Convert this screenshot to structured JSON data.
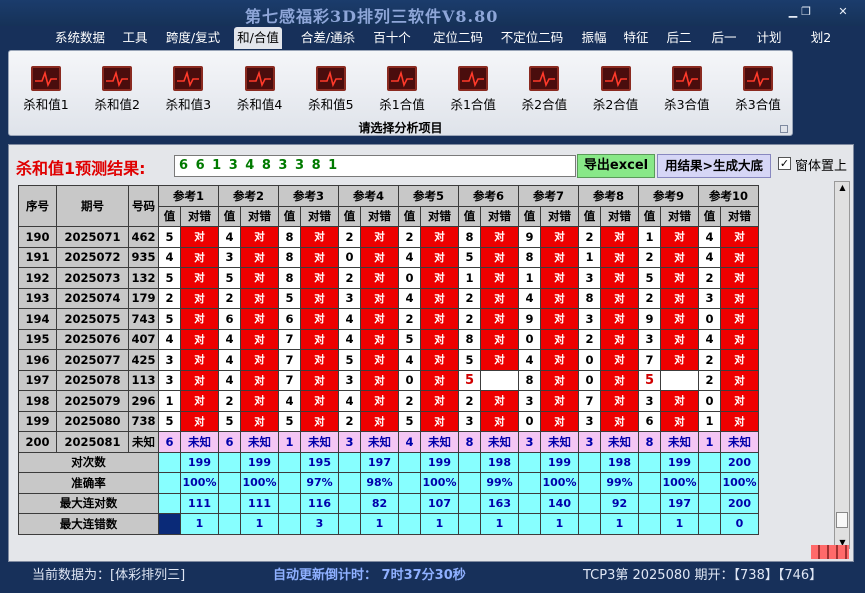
{
  "app": {
    "title": "第七感福彩3D排列三软件V8.80"
  },
  "menu": [
    "系统数据",
    "工具",
    "跨度/复式",
    "和/合值",
    "合差/通杀",
    "百十个",
    "定位二码",
    "不定位二码",
    "振幅",
    "特征",
    "后二",
    "后一",
    "计划",
    "划2"
  ],
  "menu_active": 3,
  "ribbon": {
    "buttons": [
      "杀和值1",
      "杀和值2",
      "杀和值3",
      "杀和值4",
      "杀和值5",
      "杀1合值",
      "杀1合值",
      "杀2合值",
      "杀2合值",
      "杀3合值",
      "杀3合值"
    ],
    "caption": "请选择分析项目"
  },
  "prediction": {
    "label": "杀和值1预测结果:",
    "value": "6 6 1 3 4 8 3 3 8 1",
    "export_label": "导出excel",
    "generate_label": "用结果>生成大底",
    "topmost_label": "窗体置上",
    "topmost_checked": "✓"
  },
  "table": {
    "headers": {
      "seq": "序号",
      "period": "期号",
      "number": "号码"
    },
    "ref_groups": [
      "参考1",
      "参考2",
      "参考3",
      "参考4",
      "参考5",
      "参考6",
      "参考7",
      "参考8",
      "参考9",
      "参考10"
    ],
    "sub_headers": [
      "值",
      "对错"
    ],
    "rows": [
      {
        "seq": "190",
        "period": "2025071",
        "number": "462",
        "vals": [
          "5",
          "4",
          "8",
          "2",
          "2",
          "8",
          "9",
          "2",
          "1",
          "4"
        ],
        "marks": [
          "对",
          "对",
          "对",
          "对",
          "对",
          "对",
          "对",
          "对",
          "对",
          "对"
        ]
      },
      {
        "seq": "191",
        "period": "2025072",
        "number": "935",
        "vals": [
          "4",
          "3",
          "8",
          "0",
          "4",
          "5",
          "8",
          "1",
          "2",
          "4"
        ],
        "marks": [
          "对",
          "对",
          "对",
          "对",
          "对",
          "对",
          "对",
          "对",
          "对",
          "对"
        ]
      },
      {
        "seq": "192",
        "period": "2025073",
        "number": "132",
        "vals": [
          "5",
          "5",
          "8",
          "2",
          "0",
          "1",
          "1",
          "3",
          "5",
          "2"
        ],
        "marks": [
          "对",
          "对",
          "对",
          "对",
          "对",
          "对",
          "对",
          "对",
          "对",
          "对"
        ]
      },
      {
        "seq": "193",
        "period": "2025074",
        "number": "179",
        "vals": [
          "2",
          "2",
          "5",
          "3",
          "4",
          "2",
          "4",
          "8",
          "2",
          "3"
        ],
        "marks": [
          "对",
          "对",
          "对",
          "对",
          "对",
          "对",
          "对",
          "对",
          "对",
          "对"
        ]
      },
      {
        "seq": "194",
        "period": "2025075",
        "number": "743",
        "vals": [
          "5",
          "6",
          "6",
          "4",
          "2",
          "2",
          "9",
          "3",
          "9",
          "0"
        ],
        "marks": [
          "对",
          "对",
          "对",
          "对",
          "对",
          "对",
          "对",
          "对",
          "对",
          "对"
        ]
      },
      {
        "seq": "195",
        "period": "2025076",
        "number": "407",
        "vals": [
          "4",
          "4",
          "7",
          "4",
          "5",
          "8",
          "0",
          "2",
          "3",
          "4"
        ],
        "marks": [
          "对",
          "对",
          "对",
          "对",
          "对",
          "对",
          "对",
          "对",
          "对",
          "对"
        ]
      },
      {
        "seq": "196",
        "period": "2025077",
        "number": "425",
        "vals": [
          "3",
          "4",
          "7",
          "5",
          "4",
          "5",
          "4",
          "0",
          "7",
          "2"
        ],
        "marks": [
          "对",
          "对",
          "对",
          "对",
          "对",
          "对",
          "对",
          "对",
          "对",
          "对"
        ]
      },
      {
        "seq": "197",
        "period": "2025078",
        "number": "113",
        "vals": [
          "3",
          "4",
          "7",
          "3",
          "0",
          "5",
          "8",
          "0",
          "5",
          "2"
        ],
        "marks": [
          "对",
          "对",
          "对",
          "对",
          "对",
          "",
          "对",
          "对",
          "",
          "对"
        ]
      },
      {
        "seq": "198",
        "period": "2025079",
        "number": "296",
        "vals": [
          "1",
          "2",
          "4",
          "4",
          "2",
          "2",
          "3",
          "7",
          "3",
          "0"
        ],
        "marks": [
          "对",
          "对",
          "对",
          "对",
          "对",
          "对",
          "对",
          "对",
          "对",
          "对"
        ]
      },
      {
        "seq": "199",
        "period": "2025080",
        "number": "738",
        "vals": [
          "5",
          "5",
          "5",
          "2",
          "5",
          "3",
          "0",
          "3",
          "6",
          "1"
        ],
        "marks": [
          "对",
          "对",
          "对",
          "对",
          "对",
          "对",
          "对",
          "对",
          "对",
          "对"
        ]
      }
    ],
    "miss_cells": [
      "197-5",
      "197-8"
    ],
    "pred_row": {
      "seq": "200",
      "period": "2025081",
      "number": "未知",
      "vals": [
        "6",
        "6",
        "1",
        "3",
        "4",
        "8",
        "3",
        "3",
        "8",
        "1"
      ],
      "mark": "未知"
    },
    "stats": [
      {
        "label": "对次数",
        "vals": [
          "199",
          "199",
          "195",
          "197",
          "199",
          "198",
          "199",
          "198",
          "199",
          "200"
        ]
      },
      {
        "label": "准确率",
        "vals": [
          "100%",
          "100%",
          "97%",
          "98%",
          "100%",
          "99%",
          "100%",
          "99%",
          "100%",
          "100%"
        ]
      },
      {
        "label": "最大连对数",
        "vals": [
          "111",
          "111",
          "116",
          "82",
          "107",
          "163",
          "140",
          "92",
          "197",
          "200"
        ]
      },
      {
        "label": "最大连错数",
        "vals": [
          "1",
          "1",
          "3",
          "1",
          "1",
          "1",
          "1",
          "1",
          "1",
          "0"
        ]
      }
    ]
  },
  "status": {
    "data_source": "当前数据为：[体彩排列三]",
    "countdown": "自动更新倒计时：  7时37分30秒",
    "period_info": "TCP3第 2025080 期开：【738】【746】"
  },
  "colors": {
    "hit": "#ee0000",
    "pred": "#f4c6f4",
    "stat": "#87ffff",
    "prediction_text": "#007a00",
    "title_red": "#e00000"
  }
}
